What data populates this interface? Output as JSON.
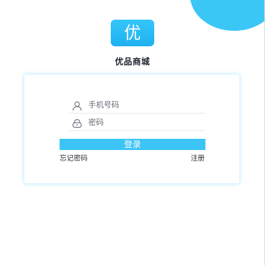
{
  "app": {
    "logo_text": "优",
    "brand_name": "优品商城"
  },
  "login_form": {
    "phone_placeholder": "手机号码",
    "password_placeholder": "密码",
    "login_button_label": "登录",
    "forgot_password_label": "忘记密码",
    "register_label": "注册"
  },
  "colors": {
    "accent": "#3cc4f7",
    "logo_bg": "#25b8f4",
    "corner_blob": "#3bc7f5",
    "card_glow": "#8fd9ff"
  },
  "icons": {
    "phone_field": "user-icon",
    "password_field": "lock-icon"
  }
}
